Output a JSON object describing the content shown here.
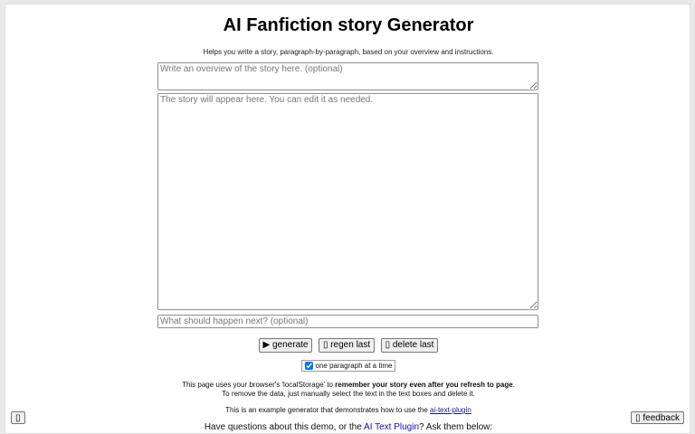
{
  "header": {
    "title": "AI Fanfiction story Generator",
    "subtitle": "Helps you write a story, paragraph-by-paragraph, based on your overview and instructions."
  },
  "inputs": {
    "overview_placeholder": "Write an overview of the story here. (optional)",
    "story_placeholder": "The story will appear here. You can edit it as needed.",
    "next_placeholder": "What should happen next? (optional)"
  },
  "buttons": {
    "generate": "▶ generate",
    "regen_last": "▯ regen last",
    "delete_last": "▯ delete last"
  },
  "options": {
    "one_paragraph_label": "one paragraph at a time",
    "one_paragraph_checked": true
  },
  "storage_note": {
    "part1": "This page uses your browser's 'localStorage' to ",
    "bold": "remember your story even after you refresh to page",
    "part2": ".",
    "line2": "To remove the data, just manually select the text in the text boxes and delete it."
  },
  "example_note": {
    "text": "This is an example generator that demonstrates how to use the ",
    "link": "ai-text-plugin"
  },
  "questions": {
    "prefix": "Have questions about this demo, or the ",
    "link": "AI Text Plugin",
    "suffix": "? Ask them below:"
  },
  "corner": {
    "left_label": "▯",
    "feedback_label": "▯ feedback"
  }
}
